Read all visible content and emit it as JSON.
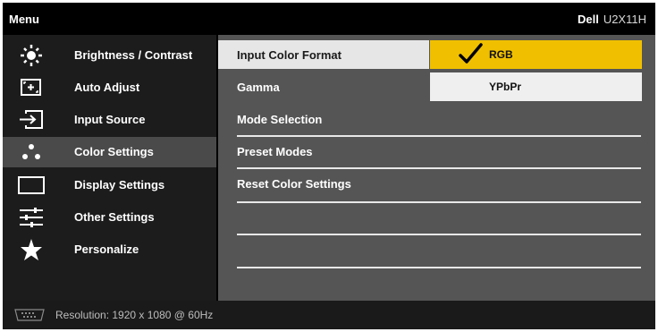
{
  "title": {
    "menu": "Menu",
    "brand": "Dell",
    "model": "U2X11H"
  },
  "sidebar": {
    "items": [
      {
        "label": "Brightness / Contrast",
        "icon": "sun-icon"
      },
      {
        "label": "Auto Adjust",
        "icon": "auto-adjust-icon"
      },
      {
        "label": "Input Source",
        "icon": "input-source-icon"
      },
      {
        "label": "Color Settings",
        "icon": "color-dots-icon",
        "active": true
      },
      {
        "label": "Display Settings",
        "icon": "display-rectangle-icon"
      },
      {
        "label": "Other Settings",
        "icon": "sliders-icon"
      },
      {
        "label": "Personalize",
        "icon": "star-icon"
      }
    ]
  },
  "content": {
    "rows": [
      {
        "label": "Input Color Format",
        "selected": true
      },
      {
        "label": "Gamma"
      },
      {
        "label": "Mode Selection"
      },
      {
        "label": "Preset Modes"
      },
      {
        "label": "Reset Color Settings"
      },
      {
        "label": ""
      },
      {
        "label": ""
      },
      {
        "label": ""
      }
    ]
  },
  "options": {
    "items": [
      {
        "label": "RGB",
        "checked": true
      },
      {
        "label": "YPbPr",
        "checked": false
      }
    ]
  },
  "status": {
    "resolution": "Resolution: 1920 x 1080 @ 60Hz",
    "icon": "dvi-connector-icon"
  },
  "colors": {
    "selected_option": "#f0c000",
    "active_sidebar": "#4a4a4a",
    "content_bg": "#555555"
  }
}
